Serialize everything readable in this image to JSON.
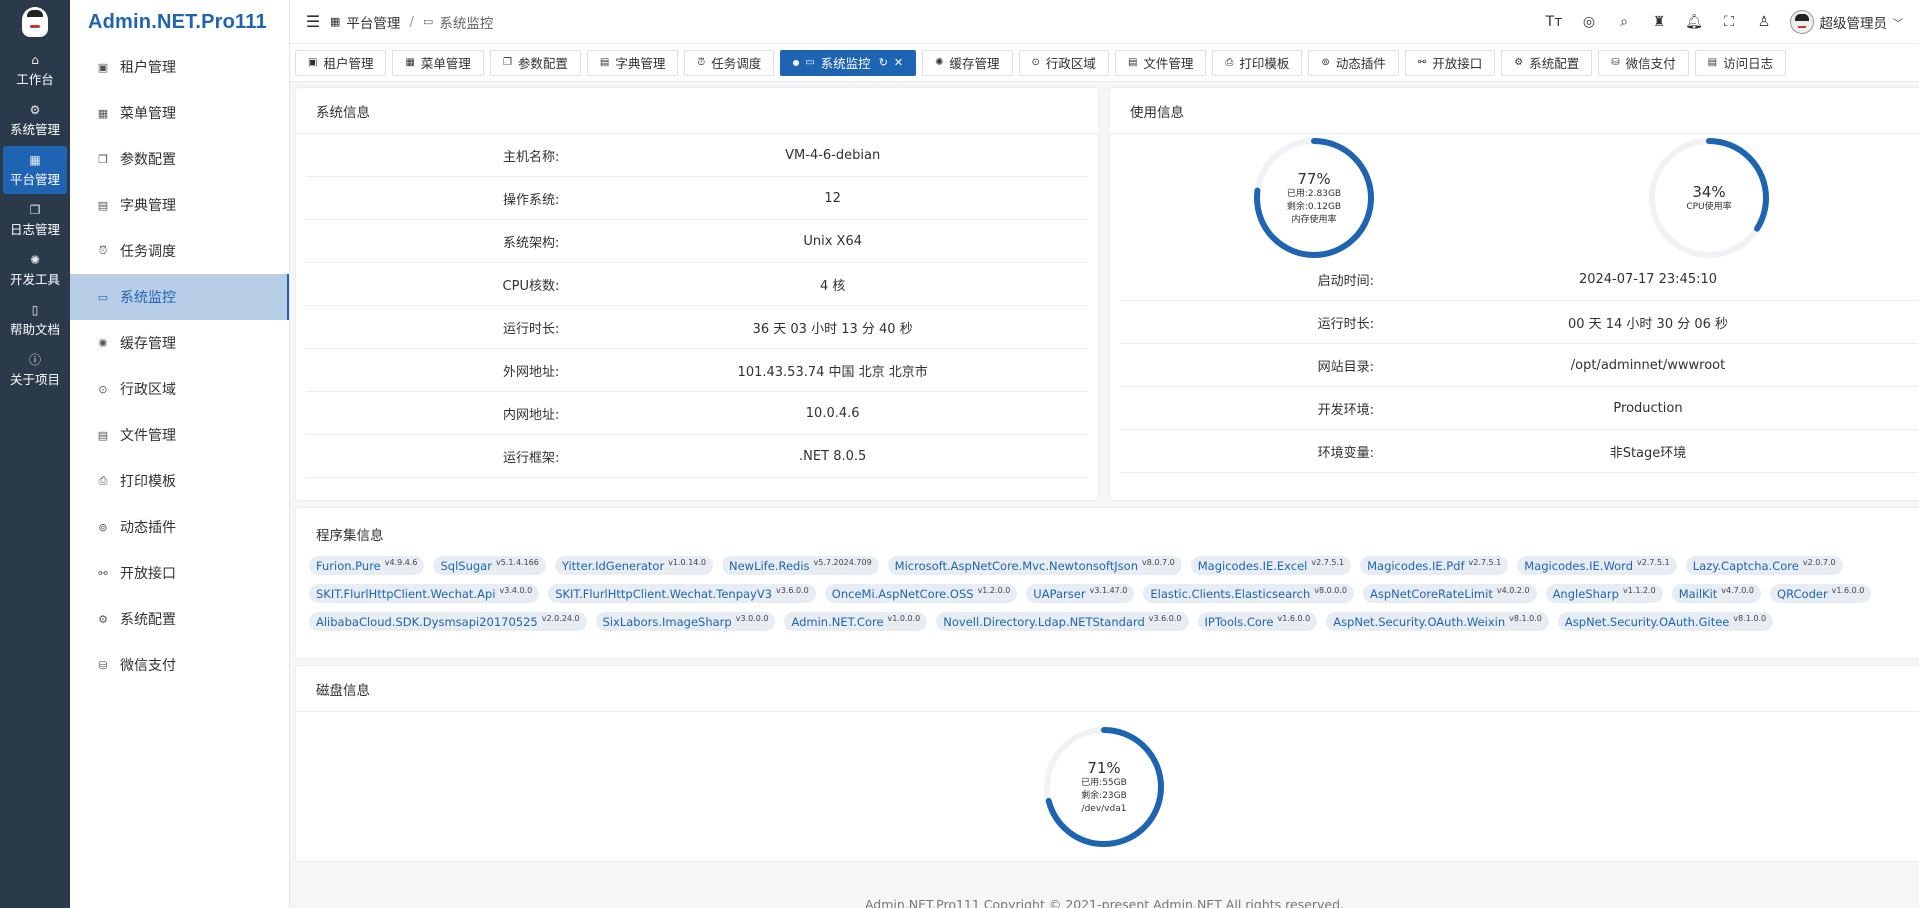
{
  "rail": {
    "items": [
      {
        "label": "工作台",
        "icon": "home-icon"
      },
      {
        "label": "系统管理",
        "icon": "gear-icon"
      },
      {
        "label": "平台管理",
        "icon": "grid-icon"
      },
      {
        "label": "日志管理",
        "icon": "copy-icon"
      },
      {
        "label": "开发工具",
        "icon": "loading-icon"
      },
      {
        "label": "帮助文档",
        "icon": "book-icon"
      },
      {
        "label": "关于项目",
        "icon": "info-icon"
      }
    ]
  },
  "brand": "Admin.NET.Pro111",
  "submenu": {
    "items": [
      {
        "label": "租户管理",
        "icon": "tenant-icon"
      },
      {
        "label": "菜单管理",
        "icon": "menu-icon"
      },
      {
        "label": "参数配置",
        "icon": "config-icon"
      },
      {
        "label": "字典管理",
        "icon": "dictionary-icon"
      },
      {
        "label": "任务调度",
        "icon": "alarm-icon"
      },
      {
        "label": "系统监控",
        "icon": "monitor-icon"
      },
      {
        "label": "缓存管理",
        "icon": "loading-icon"
      },
      {
        "label": "行政区域",
        "icon": "location-icon"
      },
      {
        "label": "文件管理",
        "icon": "file-icon"
      },
      {
        "label": "打印模板",
        "icon": "printer-icon"
      },
      {
        "label": "动态插件",
        "icon": "plugin-icon"
      },
      {
        "label": "开放接口",
        "icon": "link-icon"
      },
      {
        "label": "系统配置",
        "icon": "setting-icon"
      },
      {
        "label": "微信支付",
        "icon": "coin-icon"
      }
    ]
  },
  "header": {
    "breadcrumb_1": "平台管理",
    "breadcrumb_sep": "/",
    "breadcrumb_2": "系统监控",
    "user_name": "超级管理员"
  },
  "tabs": [
    {
      "label": "租户管理",
      "icon": "tenant-icon"
    },
    {
      "label": "菜单管理",
      "icon": "menu-icon"
    },
    {
      "label": "参数配置",
      "icon": "config-icon"
    },
    {
      "label": "字典管理",
      "icon": "dictionary-icon"
    },
    {
      "label": "任务调度",
      "icon": "alarm-icon"
    },
    {
      "label": "系统监控",
      "icon": "monitor-icon"
    },
    {
      "label": "缓存管理",
      "icon": "loading-icon"
    },
    {
      "label": "行政区域",
      "icon": "location-icon"
    },
    {
      "label": "文件管理",
      "icon": "file-icon"
    },
    {
      "label": "打印模板",
      "icon": "printer-icon"
    },
    {
      "label": "动态插件",
      "icon": "plugin-icon"
    },
    {
      "label": "开放接口",
      "icon": "link-icon"
    },
    {
      "label": "系统配置",
      "icon": "setting-icon"
    },
    {
      "label": "微信支付",
      "icon": "coin-icon"
    },
    {
      "label": "访问日志",
      "icon": "doc-icon"
    }
  ],
  "system_info": {
    "title": "系统信息",
    "rows": [
      {
        "key": "主机名称:",
        "value": "VM-4-6-debian"
      },
      {
        "key": "操作系统:",
        "value": "12"
      },
      {
        "key": "系统架构:",
        "value": "Unix X64"
      },
      {
        "key": "CPU核数:",
        "value": "4 核"
      },
      {
        "key": "运行时长:",
        "value": "36 天 03 小时 13 分 40 秒"
      },
      {
        "key": "外网地址:",
        "value": "101.43.53.74 中国 北京 北京市"
      },
      {
        "key": "内网地址:",
        "value": "10.0.4.6"
      },
      {
        "key": "运行框架:",
        "value": ".NET 8.0.5"
      }
    ]
  },
  "usage_info": {
    "title": "使用信息",
    "memory": {
      "percent": 77,
      "pct_label": "77%",
      "used": "已用:2.83GB",
      "free": "剩余:0.12GB",
      "label": "内存使用率"
    },
    "cpu": {
      "percent": 34,
      "pct_label": "34%",
      "label": "CPU使用率"
    },
    "rows": [
      {
        "key": "启动时间:",
        "value": "2024-07-17 23:45:10"
      },
      {
        "key": "运行时长:",
        "value": "00 天 14 小时 30 分 06 秒"
      },
      {
        "key": "网站目录:",
        "value": "/opt/adminnet/wwwroot"
      },
      {
        "key": "开发环境:",
        "value": "Production"
      },
      {
        "key": "环境变量:",
        "value": "非Stage环境"
      }
    ]
  },
  "assemblies": {
    "title": "程序集信息",
    "items": [
      {
        "name": "Furion.Pure",
        "version": "v4.9.4.6"
      },
      {
        "name": "SqlSugar",
        "version": "v5.1.4.166"
      },
      {
        "name": "Yitter.IdGenerator",
        "version": "v1.0.14.0"
      },
      {
        "name": "NewLife.Redis",
        "version": "v5.7.2024.709"
      },
      {
        "name": "Microsoft.AspNetCore.Mvc.NewtonsoftJson",
        "version": "v8.0.7.0"
      },
      {
        "name": "Magicodes.IE.Excel",
        "version": "v2.7.5.1"
      },
      {
        "name": "Magicodes.IE.Pdf",
        "version": "v2.7.5.1"
      },
      {
        "name": "Magicodes.IE.Word",
        "version": "v2.7.5.1"
      },
      {
        "name": "Lazy.Captcha.Core",
        "version": "v2.0.7.0"
      },
      {
        "name": "SKIT.FlurlHttpClient.Wechat.Api",
        "version": "v3.4.0.0"
      },
      {
        "name": "SKIT.FlurlHttpClient.Wechat.TenpayV3",
        "version": "v3.6.0.0"
      },
      {
        "name": "OnceMi.AspNetCore.OSS",
        "version": "v1.2.0.0"
      },
      {
        "name": "UAParser",
        "version": "v3.1.47.0"
      },
      {
        "name": "Elastic.Clients.Elasticsearch",
        "version": "v8.0.0.0"
      },
      {
        "name": "AspNetCoreRateLimit",
        "version": "v4.0.2.0"
      },
      {
        "name": "AngleSharp",
        "version": "v1.1.2.0"
      },
      {
        "name": "MailKit",
        "version": "v4.7.0.0"
      },
      {
        "name": "QRCoder",
        "version": "v1.6.0.0"
      },
      {
        "name": "AlibabaCloud.SDK.Dysmsapi20170525",
        "version": "v2.0.24.0"
      },
      {
        "name": "SixLabors.ImageSharp",
        "version": "v3.0.0.0"
      },
      {
        "name": "Admin.NET.Core",
        "version": "v1.0.0.0"
      },
      {
        "name": "Novell.Directory.Ldap.NETStandard",
        "version": "v3.6.0.0"
      },
      {
        "name": "IPTools.Core",
        "version": "v1.6.0.0"
      },
      {
        "name": "AspNet.Security.OAuth.Weixin",
        "version": "v8.1.0.0"
      },
      {
        "name": "AspNet.Security.OAuth.Gitee",
        "version": "v8.1.0.0"
      }
    ]
  },
  "disk_info": {
    "title": "磁盘信息",
    "disk": {
      "percent": 71,
      "pct_label": "71%",
      "used": "已用:55GB",
      "free": "剩余:23GB",
      "device": "/dev/vda1"
    }
  },
  "footer": "Admin.NET.Pro111 Copyright © 2021-present Admin.NET All rights reserved.",
  "colors": {
    "accent": "#1e64b2",
    "rail_bg": "#2b3a4a",
    "ring_track": "#f0f2f5"
  }
}
